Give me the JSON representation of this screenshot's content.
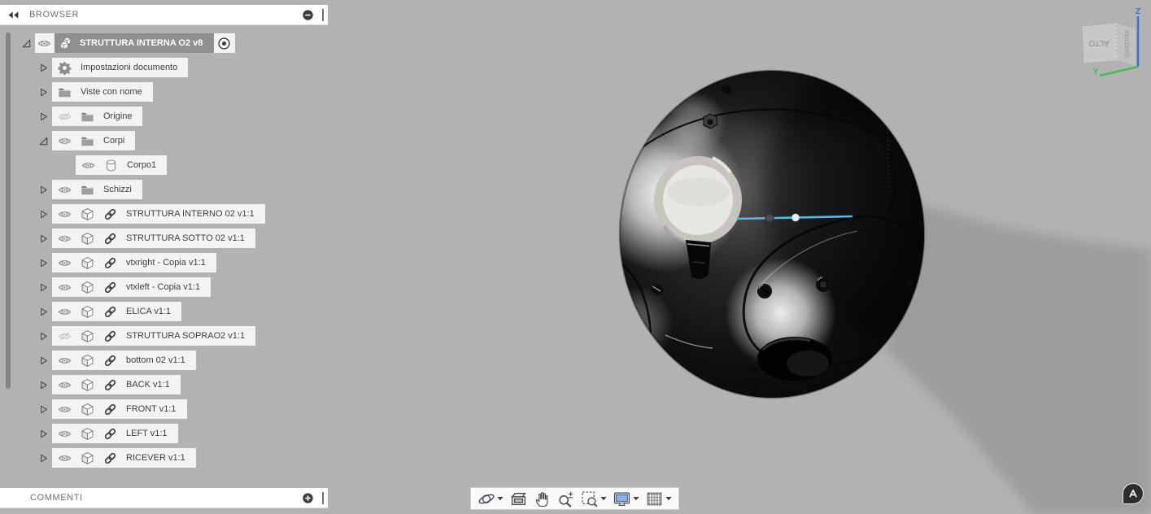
{
  "colors": {
    "canvas_background": "#b2b2b2",
    "shadow": "#9c9c9c",
    "row_box_background": "#f3f3f3",
    "selection_highlight": "#8e9092",
    "selected_edge_blue": "#54b8ea",
    "axis_z_blue": "#3a6de0",
    "axis_y_green": "#3fbf3f"
  },
  "browser_panel": {
    "title": "BROWSER",
    "collapse_icon": "double-left-arrow-icon",
    "minimize_icon": "minus-circle-icon",
    "rows": [
      {
        "label": "STRUTTURA INTERNA O2 v8",
        "level": 0,
        "arrow": "expanded",
        "eye": "on",
        "icon": "component",
        "link": false,
        "selected": true,
        "radio": true
      },
      {
        "label": "Impostazioni documento",
        "level": 1,
        "arrow": "collapsed",
        "eye": null,
        "icon": "gear",
        "link": false,
        "selected": false,
        "radio": false
      },
      {
        "label": "Viste con nome",
        "level": 1,
        "arrow": "collapsed",
        "eye": null,
        "icon": "folder",
        "link": false,
        "selected": false,
        "radio": false
      },
      {
        "label": "Origine",
        "level": 1,
        "arrow": "collapsed",
        "eye": "off",
        "icon": "folder",
        "link": false,
        "selected": false,
        "radio": false
      },
      {
        "label": "Corpi",
        "level": 1,
        "arrow": "expanded",
        "eye": "on",
        "icon": "folder",
        "link": false,
        "selected": false,
        "radio": false
      },
      {
        "label": "Corpo1",
        "level": 2,
        "arrow": null,
        "eye": "on",
        "icon": "body",
        "link": false,
        "selected": false,
        "radio": false
      },
      {
        "label": "Schizzi",
        "level": 1,
        "arrow": "collapsed",
        "eye": "on",
        "icon": "folder",
        "link": false,
        "selected": false,
        "radio": false
      },
      {
        "label": "STRUTTURA INTERNO 02 v1:1",
        "level": 1,
        "arrow": "collapsed",
        "eye": "on",
        "icon": "cube",
        "link": true,
        "selected": false,
        "radio": false
      },
      {
        "label": "STRUTTURA SOTTO 02 v1:1",
        "level": 1,
        "arrow": "collapsed",
        "eye": "on",
        "icon": "cube",
        "link": true,
        "selected": false,
        "radio": false
      },
      {
        "label": "vtxright - Copia v1:1",
        "level": 1,
        "arrow": "collapsed",
        "eye": "on",
        "icon": "cube",
        "link": true,
        "selected": false,
        "radio": false
      },
      {
        "label": "vtxleft - Copia v1:1",
        "level": 1,
        "arrow": "collapsed",
        "eye": "on",
        "icon": "cube",
        "link": true,
        "selected": false,
        "radio": false
      },
      {
        "label": "ELICA v1:1",
        "level": 1,
        "arrow": "collapsed",
        "eye": "on",
        "icon": "cube",
        "link": true,
        "selected": false,
        "radio": false
      },
      {
        "label": "STRUTTURA SOPRAO2 v1:1",
        "level": 1,
        "arrow": "collapsed",
        "eye": "off",
        "icon": "cube",
        "link": true,
        "selected": false,
        "radio": false
      },
      {
        "label": "bottom 02 v1:1",
        "level": 1,
        "arrow": "collapsed",
        "eye": "on",
        "icon": "cube",
        "link": true,
        "selected": false,
        "radio": false
      },
      {
        "label": "BACK v1:1",
        "level": 1,
        "arrow": "collapsed",
        "eye": "on",
        "icon": "cube",
        "link": true,
        "selected": false,
        "radio": false
      },
      {
        "label": "FRONT v1:1",
        "level": 1,
        "arrow": "collapsed",
        "eye": "on",
        "icon": "cube",
        "link": true,
        "selected": false,
        "radio": false
      },
      {
        "label": "LEFT v1:1",
        "level": 1,
        "arrow": "collapsed",
        "eye": "on",
        "icon": "cube",
        "link": true,
        "selected": false,
        "radio": false
      },
      {
        "label": "RICEVER v1:1",
        "level": 1,
        "arrow": "collapsed",
        "eye": "on",
        "icon": "cube",
        "link": true,
        "selected": false,
        "radio": false
      }
    ]
  },
  "comments_panel": {
    "title": "COMMENTI",
    "add_icon": "plus-circle-icon"
  },
  "navbar": {
    "buttons": [
      {
        "icon": "orbit",
        "dropdown": true
      },
      {
        "icon": "look-at",
        "dropdown": false
      },
      {
        "icon": "pan",
        "dropdown": false
      },
      {
        "icon": "zoom",
        "dropdown": false
      },
      {
        "icon": "fit",
        "dropdown": true
      },
      {
        "icon": "display-settings",
        "dropdown": true
      },
      {
        "icon": "grid-display",
        "dropdown": true
      }
    ]
  },
  "viewcube": {
    "front_face": "ALTO",
    "side_face": "SINISTRA",
    "z_label": "Z",
    "y_label": "Y"
  },
  "assistant": {
    "icon": "autodesk-assistant"
  }
}
